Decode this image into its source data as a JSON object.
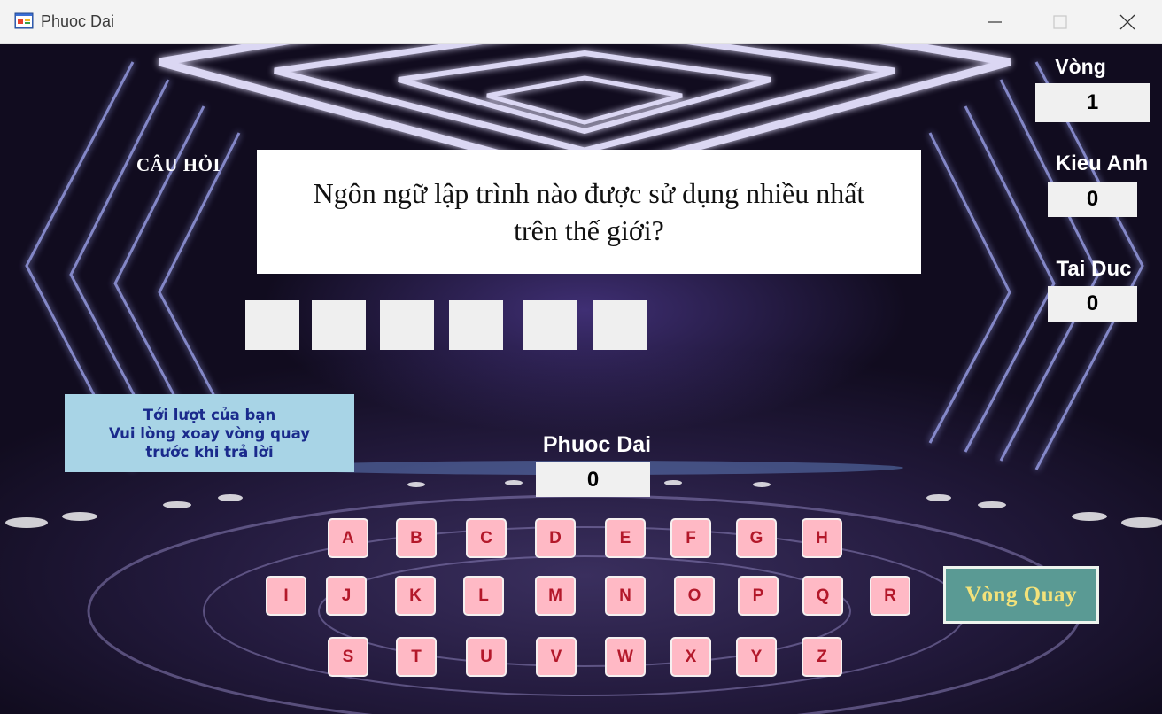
{
  "window": {
    "title": "Phuoc Dai",
    "icon": "app-window-icon",
    "controls": [
      "minimize-icon",
      "maximize-icon",
      "close-icon"
    ]
  },
  "question": {
    "label": "CÂU HỎI",
    "line1": "Ngôn ngữ lập trình nào được sử dụng nhiều nhất",
    "line2": "trên thế giới?",
    "answer_slots": [
      "",
      "",
      "",
      "",
      "",
      ""
    ]
  },
  "turn_notice": {
    "line1": "Tới lượt của bạn",
    "line2": "Vui lòng xoay vòng quay",
    "line3": "trước khi trả lời"
  },
  "round": {
    "label": "Vòng",
    "value": "1"
  },
  "players": {
    "p1": {
      "name": "Kieu Anh",
      "score": "0"
    },
    "p2": {
      "name": "Tai Duc",
      "score": "0"
    },
    "current": {
      "name": "Phuoc Dai",
      "score": "0"
    }
  },
  "keyboard": {
    "row1": [
      "A",
      "B",
      "C",
      "D",
      "E",
      "F",
      "G",
      "H"
    ],
    "row2": [
      "I",
      "J",
      "K",
      "L",
      "M",
      "N",
      "O",
      "P",
      "Q",
      "R"
    ],
    "row3": [
      "S",
      "T",
      "U",
      "V",
      "W",
      "X",
      "Y",
      "Z"
    ]
  },
  "spin_button": {
    "label": "Vòng Quay"
  },
  "colors": {
    "letter_bg": "#ffb9c5",
    "letter_text": "#b3182a",
    "turn_bg": "#a8d4e6",
    "turn_text": "#1a2a8c",
    "spin_bg": "#5a9a94",
    "spin_text": "#f3e27a"
  }
}
